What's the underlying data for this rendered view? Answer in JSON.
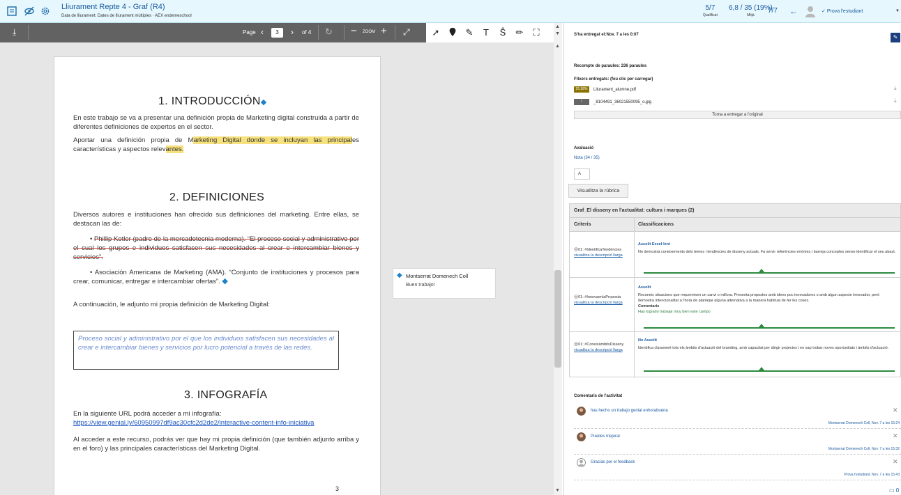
{
  "header": {
    "title": "Lliurament Repte 4 - Graf (R4)",
    "subtitle": "Data de lliurament: Dates de lliurament múltiples · AEX endemeschool",
    "stats": [
      {
        "value": "5/7",
        "label": "Qualificat"
      },
      {
        "value": "6,8 / 35 (19%)",
        "label": "Mitjà"
      },
      {
        "value": "7/7",
        "label": ""
      }
    ],
    "student_name": "Prova l'estudiant"
  },
  "pdf_toolbar": {
    "page_label": "Page",
    "current_page": "3",
    "of_pages": "of 4",
    "zoom_label": "ZOOM"
  },
  "document": {
    "h1": "1.   INTRODUCCIÓN",
    "p1": "En este trabajo se va a presentar una definición propia de Marketing digital construida a partir de diferentes definiciones de expertos en el sector.",
    "p2_a": "Aportar una definición propia de M",
    "p2_b": "arketing Digital donde se incluyan las principal",
    "p2_c": "es características y aspectos relev",
    "p2_d": "antes.",
    "h2": "2.   DEFINICIONES",
    "p3": "Diversos autores e instituciones han ofrecido sus definiciones del marketing. Entre ellas,  se destacan las de:",
    "bullet1": "Phillip Kotler (padre de la mercadotecnia moderna). “El proceso social y administrativo por el cual los grupos e individuos satisfacen sus necesidades al crear e intercambiar bienes y servicios”.",
    "bullet2": "Asociación Americana de Marketing (AMA). “Conjunto de instituciones y procesos para crear, comunicar, entregar e intercambiar ofertas”.",
    "p4": "A continuación, le adjunto mi propia definición de Marketing Digital:",
    "definition": "Proceso social y administrativo por el que los individuos satisfacen sus necesidades al crear e intercambiar bienes y servicios por lucro potencial a través de las redes.",
    "h3": "3.   INFOGRAFÍA",
    "p5": "En la siguiente URL podrá acceder a mi infografía:",
    "link": "https://view.genial.ly/60950997df9ac30cfc2d2de2/interactive-content-info-iniciativa",
    "p6": "Al acceder a este recurso, podrás ver que hay mi propia definición (que también adjunto arriba y en el foro) y las principales características del Marketing Digital.",
    "page_number": "3"
  },
  "annotation": {
    "author": "Montserrat Domenech Coll",
    "text": "Buen trabajo!"
  },
  "panel": {
    "submitted": "S'ha entregat el:Nov. 7 a les 0:07",
    "word_count": "Recompte de paraules: 236 paraules",
    "files_label": "Fitxers entregats: (feu clic per carregar)",
    "files": [
      {
        "badge": "25,58%",
        "name": "Lliurament_alumne.pdf",
        "color": "#8a7200"
      },
      {
        "badge": "!",
        "name": "_8104491_36021550095_o.jpg",
        "color": "#666666"
      }
    ],
    "resubmit": "Torna a entregar a l'original",
    "evaluation_label": "Avaluació",
    "grade": "Nota (34 / 35)",
    "grade_value": "A",
    "rubric_button": "Visualitza la rúbrica"
  },
  "rubric": {
    "title": "Graf_El disseny en l'actualitat: cultura i marques (2)",
    "col_criteria": "Criteris",
    "col_levels": "Classificacions",
    "rows": [
      {
        "criterion": "01: #IdentificaTendències",
        "link": "visualitza la descripció llarga",
        "level": "Assolit Excel·lent",
        "desc": "No demostra coneixements dels temes i tendències de disseny actuals. Fa servir referències errònies i barreja conceptes sense identificar el seu abast.",
        "comment_title": "",
        "comment": "",
        "level_pos": 0.47
      },
      {
        "criterion": "01: #InnovaenlaProposta",
        "link": "visualitza la descripció llarga",
        "level": "Assolit",
        "desc": "Reconeix situacions que requereixen un canvi o millora. Presenta propostes amb idees poc innovadores o amb algun aspecte innovador, però demostra intencionalitat a l'hora de plantejar alguna alternativa a la manera habitual de fer les coses.",
        "comment_title": "Comentaris",
        "comment": "Has logrado trabajar muy bien este campo",
        "level_pos": 0.47
      },
      {
        "criterion": "01: #ConeixàmbitsDisseny",
        "link": "visualitza la descripció llarga",
        "level": "No Assolit",
        "desc": "Identifica clarament tots els àmbits d'actuació del branding, amb capacitat per dirigir projectes i en sap trobar noves oportunitats i àmbits d'actuació.",
        "comment_title": "",
        "comment": "",
        "level_pos": 0.47
      }
    ]
  },
  "comments": {
    "title": "Comentaris de l'activitat",
    "items": [
      {
        "text": "has hecho un trabajo genial enhorabuena",
        "meta": "Montserrat Domenech Coll, Nov. 7 a les 15:24"
      },
      {
        "text": "Puedes mejorar",
        "meta": "Montserrat Domenech Coll, Nov. 7 a les 15:32"
      },
      {
        "text": "Gracias por el feedback",
        "meta": "Prova l'estudiant, Nov. 7 a les 15:43"
      }
    ],
    "feedback_count": "0"
  }
}
